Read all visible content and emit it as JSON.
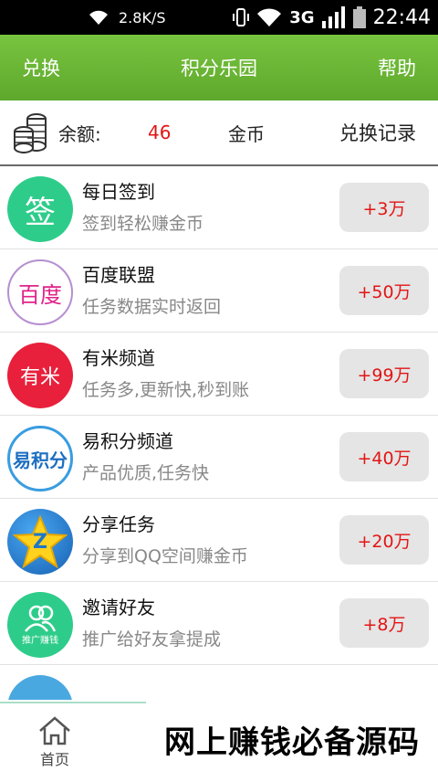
{
  "status_bar": {
    "speed": "2.8K/S",
    "network": "3G",
    "time": "22:44"
  },
  "app_bar": {
    "left_label": "兑换",
    "title": "积分乐园",
    "right_label": "帮助"
  },
  "balance": {
    "label": "余额:",
    "value": "46",
    "unit": "金币",
    "record_label": "兑换记录"
  },
  "tasks": [
    {
      "icon": "sign-in-icon",
      "icon_text": "签",
      "title": "每日签到",
      "subtitle": "签到轻松赚金币",
      "reward": "+3万",
      "color": "#2ecc8a"
    },
    {
      "icon": "baidu-icon",
      "icon_text": "百度",
      "title": "百度联盟",
      "subtitle": "任务数据实时返回",
      "reward": "+50万",
      "color": "#ffffff"
    },
    {
      "icon": "youmi-icon",
      "icon_text": "有米",
      "title": "有米频道",
      "subtitle": "任务多,更新快,秒到账",
      "reward": "+99万",
      "color": "#e8203b"
    },
    {
      "icon": "yijifen-icon",
      "icon_text": "易积分",
      "title": "易积分频道",
      "subtitle": "产品优质,任务快",
      "reward": "+40万",
      "color": "#ffffff"
    },
    {
      "icon": "qzone-star-icon",
      "icon_text": "Z",
      "title": "分享任务",
      "subtitle": "分享到QQ空间赚金币",
      "reward": "+20万",
      "color": "#1f77c9"
    },
    {
      "icon": "invite-friends-icon",
      "icon_text": "推广赚钱",
      "title": "邀请好友",
      "subtitle": "推广给好友拿提成",
      "reward": "+8万",
      "color": "#2ecc8a"
    }
  ],
  "bottom_nav": {
    "home_label": "首页"
  },
  "watermark": "网上赚钱必备源码"
}
